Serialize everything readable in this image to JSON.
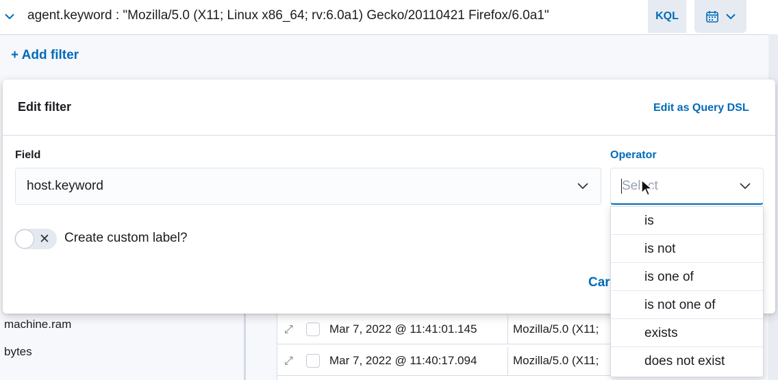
{
  "query_bar": {
    "query": "agent.keyword : \"Mozilla/5.0 (X11; Linux x86_64; rv:6.0a1) Gecko/20110421 Firefox/6.0a1\"",
    "language": "KQL"
  },
  "add_filter_label": "+ Add filter",
  "sidebar": {
    "fields": [
      "machine.ram",
      "bytes"
    ]
  },
  "table": {
    "rows": [
      {
        "timestamp": "Mar 7, 2022 @ 11:41:01.145",
        "agent": "Mozilla/5.0 (X11;"
      },
      {
        "timestamp": "Mar 7, 2022 @ 11:40:17.094",
        "agent": "Mozilla/5.0 (X11;"
      }
    ]
  },
  "edit_filter": {
    "title": "Edit filter",
    "edit_dsl": "Edit as Query DSL",
    "field_label": "Field",
    "field_value": "host.keyword",
    "operator_label": "Operator",
    "operator_placeholder": "Select",
    "custom_label": "Create custom label?",
    "cancel_partial": "Car"
  },
  "operator_options": [
    "is",
    "is not",
    "is one of",
    "is not one of",
    "exists",
    "does not exist"
  ],
  "colors": {
    "accent": "#006bb8",
    "text": "#1a1c21",
    "border": "#d3dae6"
  },
  "icons": [
    "chevron-down-icon",
    "calendar-icon",
    "expand-icon",
    "close-icon",
    "mouse-pointer-icon"
  ]
}
